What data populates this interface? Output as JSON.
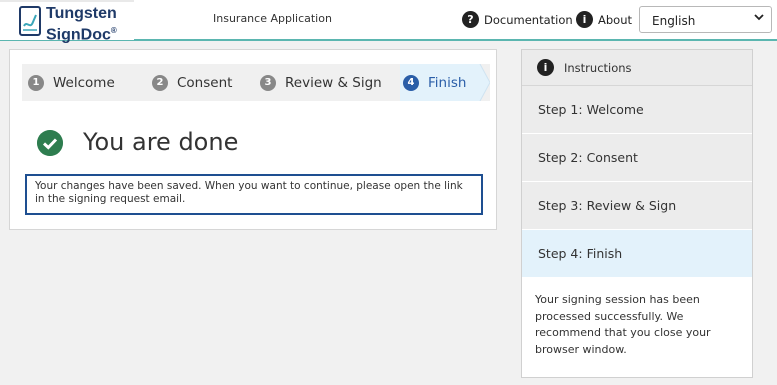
{
  "header": {
    "logo_line1": "Tungsten",
    "logo_line2": "SignDoc",
    "logo_reg": "®",
    "app_title": "Insurance Application",
    "documentation_label": "Documentation",
    "about_label": "About",
    "language_selected": "English",
    "help_icon_glyph": "?",
    "info_icon_glyph": "i"
  },
  "steps": [
    {
      "num": "1",
      "label": "Welcome"
    },
    {
      "num": "2",
      "label": "Consent"
    },
    {
      "num": "3",
      "label": "Review & Sign"
    },
    {
      "num": "4",
      "label": "Finish"
    }
  ],
  "main": {
    "title": "You are done",
    "notice": "Your changes have been saved. When you want to continue, please open the link in the signing request email."
  },
  "instructions": {
    "title": "Instructions",
    "info_icon_glyph": "i",
    "steps": [
      "Step 1: Welcome",
      "Step 2: Consent",
      "Step 3: Review & Sign",
      "Step 4: Finish"
    ],
    "text": "Your signing session has been processed successfully. We recommend that you close your browser window."
  },
  "colors": {
    "accent_blue": "#2a5ea8",
    "success_green": "#2e7d4f",
    "header_rule": "#5bb6b0",
    "active_step_bg": "#e3f2fb"
  }
}
